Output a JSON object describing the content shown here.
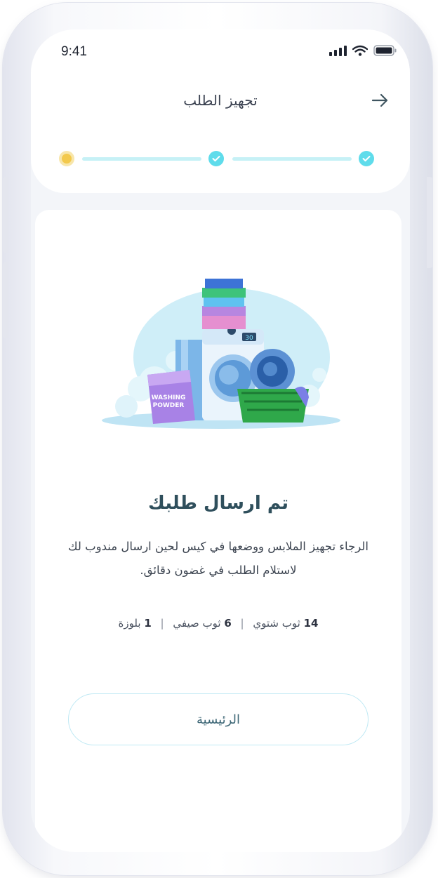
{
  "status_bar": {
    "time": "9:41"
  },
  "header": {
    "title": "تجهيز الطلب"
  },
  "stepper": {
    "steps": [
      "current",
      "done",
      "done"
    ]
  },
  "confirmation": {
    "heading": "تم ارسال طلبك",
    "description": "الرجاء تجهيز الملابس ووضعها في كيس لحين ارسال مندوب لك لاستلام الطلب في غضون دقائق.",
    "items": [
      {
        "count": "14",
        "label": "ثوب شتوي"
      },
      {
        "count": "6",
        "label": "ثوب صيفي"
      },
      {
        "count": "1",
        "label": "بلوزة"
      }
    ],
    "illustration": {
      "powder_text_1": "WASHING",
      "powder_text_2": "POWDER",
      "display_text": "30"
    }
  },
  "actions": {
    "home_label": "الرئيسية"
  },
  "colors": {
    "accent": "#5fdceb",
    "current_step": "#f3c94c",
    "heading": "#2f4f5c"
  }
}
